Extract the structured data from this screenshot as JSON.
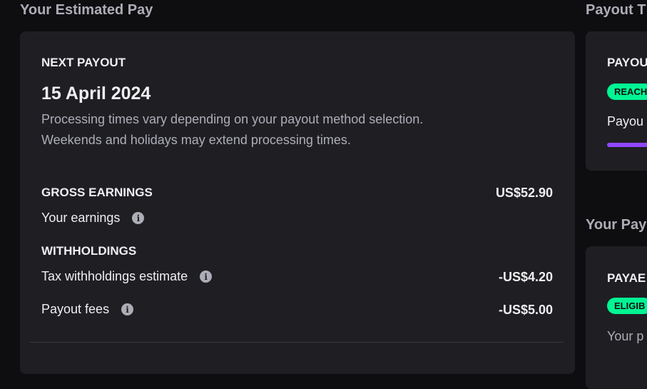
{
  "estimated_pay": {
    "title": "Your Estimated Pay",
    "next_payout_label": "NEXT PAYOUT",
    "next_payout_date": "15 April 2024",
    "description_line1": "Processing times vary depending on your payout method selection.",
    "description_line2": "Weekends and holidays may extend processing times.",
    "gross_earnings_label": "GROSS EARNINGS",
    "gross_earnings_value": "US$52.90",
    "your_earnings_label": "Your earnings",
    "withholdings_label": "WITHHOLDINGS",
    "tax_label": "Tax withholdings estimate",
    "tax_value": "-US$4.20",
    "fees_label": "Payout fees",
    "fees_value": "-US$5.00"
  },
  "payout_threshold": {
    "title": "Payout T",
    "caption": "PAYOU",
    "status_pill": "REACH",
    "text": "Payou",
    "accent_color": "#9147ff"
  },
  "your_payout": {
    "title": "Your Pay",
    "caption": "PAYAE",
    "status_pill": "ELIGIB",
    "text": "Your p"
  },
  "icons": {
    "info": "info-icon"
  },
  "colors": {
    "background": "#0e0e10",
    "card": "#1f1f23",
    "pill": "#00f593"
  }
}
